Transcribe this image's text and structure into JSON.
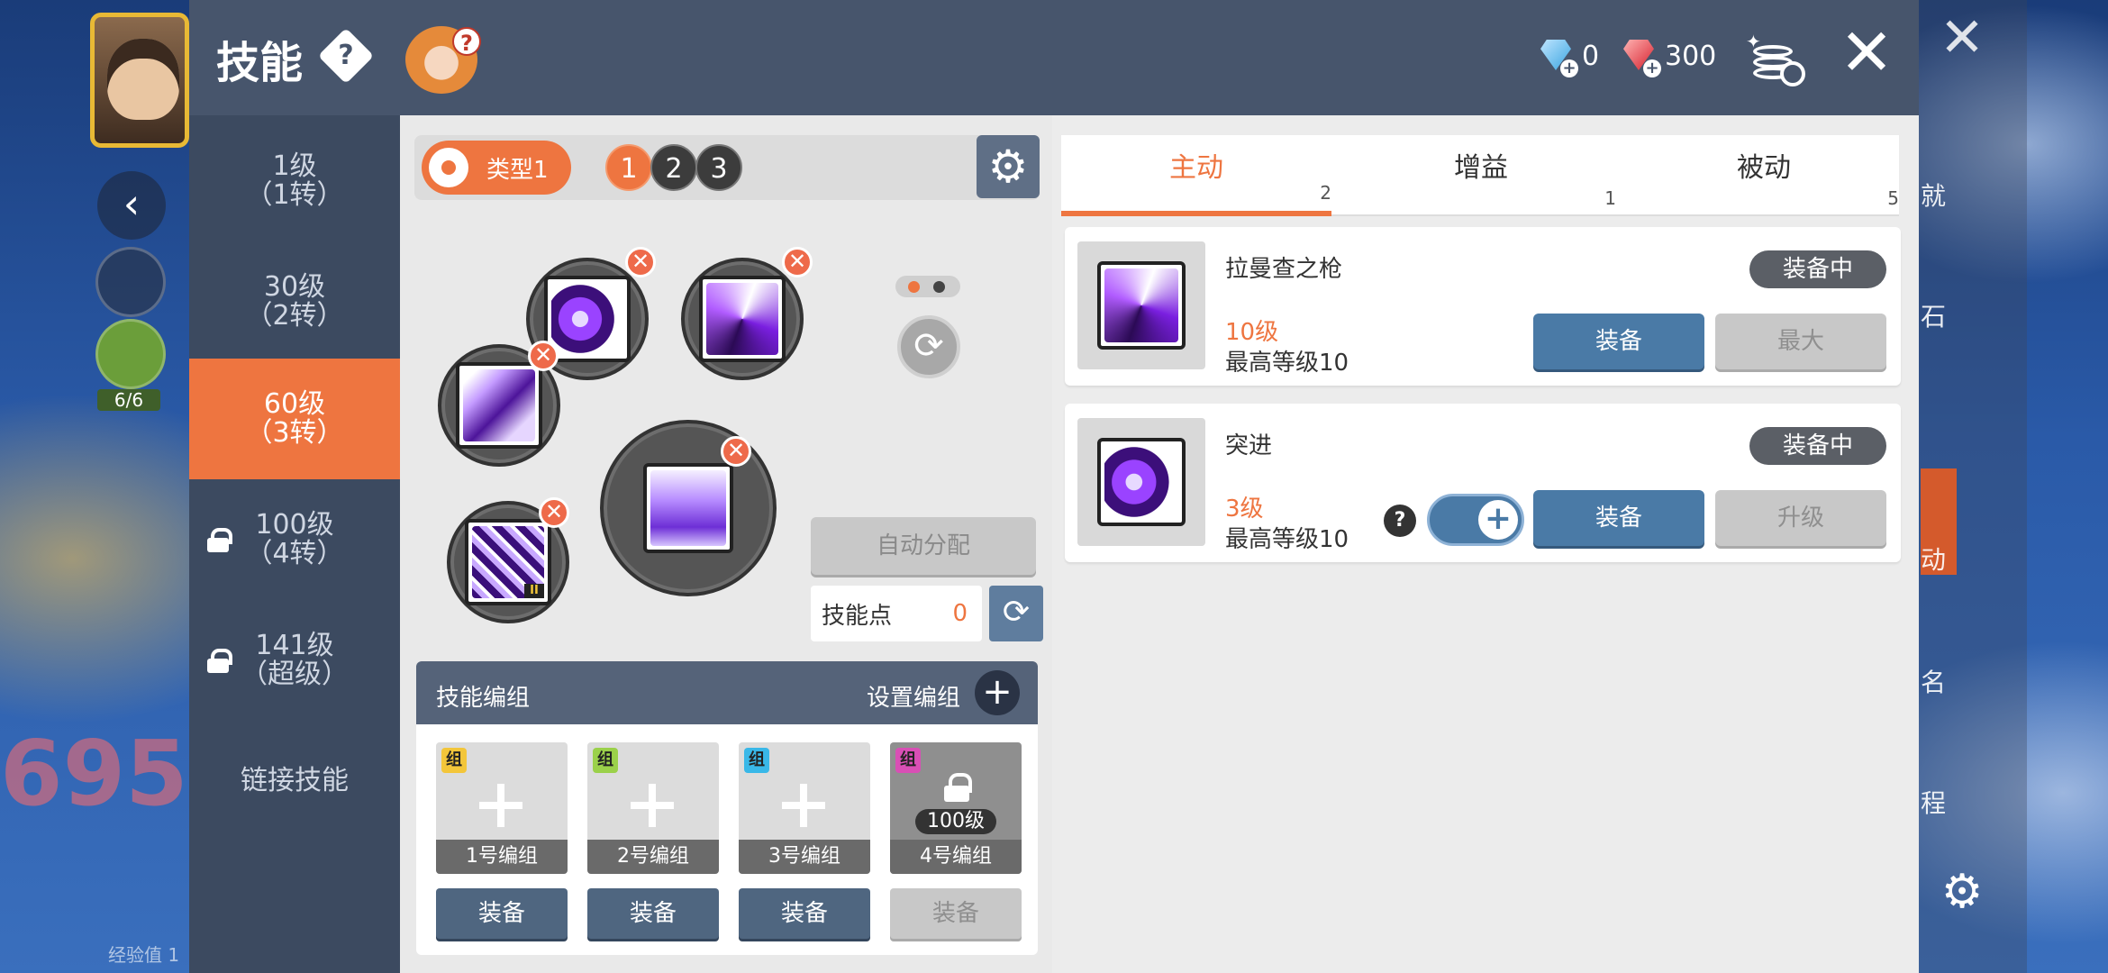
{
  "header": {
    "title": "技能",
    "help_symbol": "?",
    "mascot_badge": "?",
    "blue_gem_count": "0",
    "red_gem_count": "300",
    "close_symbol": "✕"
  },
  "background": {
    "back_symbol": "‹",
    "buff_count": "6/6",
    "level_text": "695",
    "exp_text": "经验值 1",
    "close_symbol": "✕",
    "menu_labels": [
      "就",
      "石",
      "动",
      "名",
      "程"
    ]
  },
  "sidebar": {
    "items": [
      {
        "line1": "1级",
        "line2": "（1转）",
        "locked": false,
        "active": false
      },
      {
        "line1": "30级",
        "line2": "（2转）",
        "locked": false,
        "active": false
      },
      {
        "line1": "60级",
        "line2": "（3转）",
        "locked": false,
        "active": true
      },
      {
        "line1": "100级",
        "line2": "（4转）",
        "locked": true,
        "active": false
      },
      {
        "line1": "141级",
        "line2": "（超级）",
        "locked": true,
        "active": false
      }
    ],
    "link_skill": "链接技能"
  },
  "typebar": {
    "type_label": "类型1",
    "numbers": [
      "1",
      "2",
      "3"
    ],
    "active_number": "1"
  },
  "skill_slots": {
    "remove_symbol": "✕",
    "tier_badge": "II"
  },
  "controls": {
    "auto_assign": "自动分配",
    "skill_points_label": "技能点",
    "skill_points_value": "0"
  },
  "presets": {
    "title": "技能编组",
    "set_label": "设置编组",
    "group_tag": "组",
    "group_tag_colors": [
      "#f3c63a",
      "#9bd14a",
      "#39b8e8",
      "#d94fb5"
    ],
    "cards": [
      {
        "name": "1号编组",
        "locked": false,
        "equip": "装备"
      },
      {
        "name": "2号编组",
        "locked": false,
        "equip": "装备"
      },
      {
        "name": "3号编组",
        "locked": false,
        "equip": "装备"
      },
      {
        "name": "4号编组",
        "locked": true,
        "equip": "装备",
        "lock_level": "100级"
      }
    ]
  },
  "tabs": [
    {
      "label": "主动",
      "count": "2",
      "active": true
    },
    {
      "label": "增益",
      "count": "1",
      "active": false
    },
    {
      "label": "被动",
      "count": "5",
      "active": false
    }
  ],
  "skills": [
    {
      "name": "拉曼查之枪",
      "level": "10级",
      "max_level": "最高等级10",
      "status": "装备中",
      "equip": "装备",
      "secondary": "最大"
    },
    {
      "name": "突进",
      "level": "3级",
      "max_level": "最高等级10",
      "status": "装备中",
      "equip": "装备",
      "secondary": "升级",
      "help": "?",
      "toggle_symbol": "+"
    }
  ],
  "colors": {
    "accent": "#ee7540",
    "header": "#47556c",
    "sidebar": "#3c4a60",
    "equip_blue": "#4a7aa6"
  }
}
